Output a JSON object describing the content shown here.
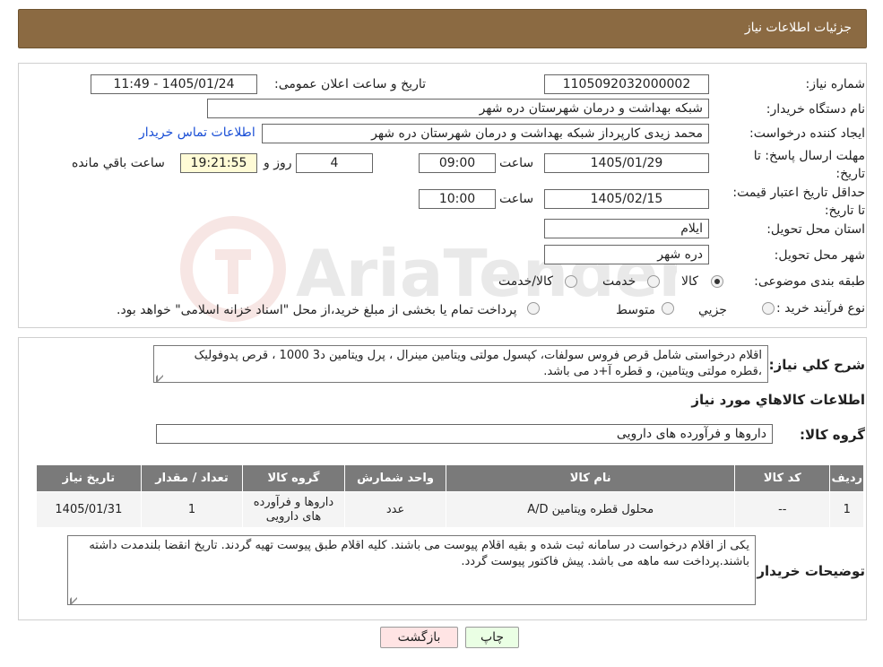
{
  "header": {
    "title": "جزئیات اطلاعات نیاز"
  },
  "form": {
    "need_number_label": "شماره نیاز:",
    "need_number": "1105092032000002",
    "announce_label": "تاریخ و ساعت اعلان عمومی:",
    "announce_value": "1405/01/24 - 11:49",
    "buyer_org_label": "نام دستگاه خریدار:",
    "buyer_org": "شبکه بهداشت و درمان شهرستان دره شهر",
    "requester_label": "ایجاد کننده درخواست:",
    "requester": "محمد زیدی کارپرداز شبکه بهداشت و درمان شهرستان دره شهر",
    "buyer_contact_link": "اطلاعات تماس خریدار",
    "deadline_label": "مهلت ارسال پاسخ: تا تاریخ:",
    "deadline_date": "1405/01/29",
    "time_label": "ساعت",
    "deadline_time": "09:00",
    "days_value": "4",
    "days_label": "روز و",
    "remaining_time": "19:21:55",
    "remaining_label": "ساعت باقي مانده",
    "validity_label": "حداقل تاریخ اعتبار قیمت: تا تاریخ:",
    "validity_date": "1405/02/15",
    "validity_time": "10:00",
    "province_label": "استان محل تحویل:",
    "province": "ایلام",
    "city_label": "شهر محل تحویل:",
    "city": "دره شهر",
    "category_label": "طبقه بندی موضوعی:",
    "category_options": [
      "کالا",
      "خدمت",
      "کالا/خدمت"
    ],
    "category_selected": "کالا",
    "process_label": "نوع فرآیند خرید :",
    "process_options": [
      "جزیي",
      "متوسط"
    ],
    "process_note": "پرداخت تمام یا بخشی از مبلغ خرید،از محل \"اسناد خزانه اسلامی\" خواهد بود."
  },
  "description": {
    "label": "شرح کلي نياز:",
    "text": "اقلام درخواستی شامل قرص فروس سولفات، کپسول مولتی ویتامین مینرال ، پرل ویتامین د3 1000 ، قرص پدوفولیک ،قطره مولتی ویتامین، و قطره آ+د می باشد."
  },
  "goods": {
    "section_title": "اطلاعات کالاهاي مورد نياز",
    "group_label": "گروه کالا:",
    "group_value": "داروها و فرآورده های دارویی",
    "columns": [
      "ردیف",
      "کد کالا",
      "نام کالا",
      "واحد شمارش",
      "گروه کالا",
      "تعداد / مقدار",
      "تاریخ نیاز"
    ],
    "rows": [
      [
        "1",
        "--",
        "محلول قطره ویتامین A/D",
        "عدد",
        "داروها و فرآورده های دارویی",
        "1",
        "1405/01/31"
      ]
    ]
  },
  "buyer_notes": {
    "label": "توضیحات خریدار:",
    "text": "یکی از اقلام درخواست در سامانه ثبت شده و بقیه اقلام پیوست می باشند. کلیه اقلام طبق پیوست تهیه گردند. تاریخ انقضا بلندمدت داشته باشند.پرداخت سه ماهه می باشد. پیش فاکتور پیوست گردد."
  },
  "buttons": {
    "print": "چاپ",
    "back": "بازگشت"
  },
  "watermark": {
    "text": "AriaTender.neT"
  },
  "colors": {
    "header": "#8b6a42",
    "table_header": "#7a7a7a",
    "link": "#1a4fd6"
  }
}
